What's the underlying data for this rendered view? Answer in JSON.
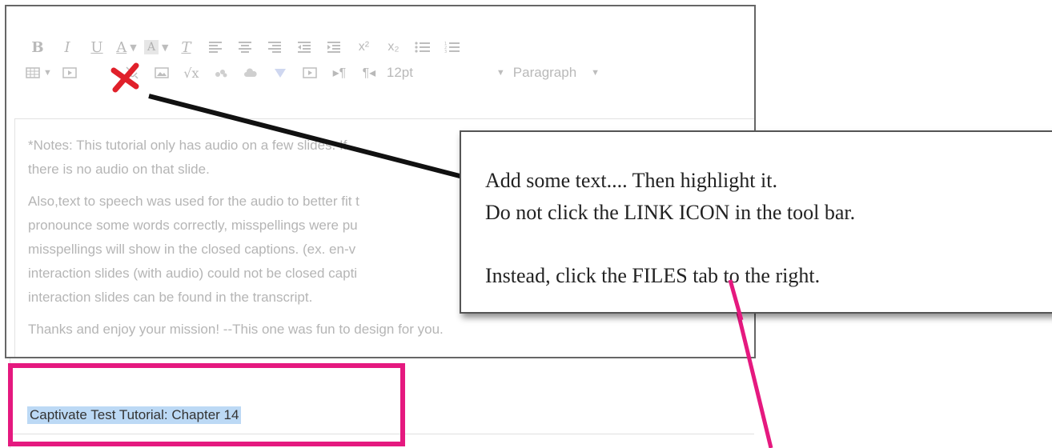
{
  "toolbar": {
    "row1": [
      "B",
      "I",
      "U",
      "A",
      "A",
      "T",
      "align-left",
      "align-center",
      "align-right",
      "indent-decrease",
      "indent-increase",
      "x²",
      "x₂",
      "bullet-list",
      "numbered-list"
    ],
    "font_size": "12pt",
    "block_format": "Paragraph",
    "underline_label": "U",
    "bold_label": "B",
    "italic_label": "I",
    "font_color_label": "A",
    "bg_color_label": "A",
    "clear_format_label": "T",
    "superscript_label": "x²",
    "subscript_label": "x₂"
  },
  "content": {
    "paragraphs": [
      "*Notes:  This tutorial only has audio on a few slides.  If there is no audio on that slide.",
      "Also,text to speech was used for the audio to better fit the pronounce some words correctly, misspellings were put misspellings will show in the closed captions.  (ex. en-v interaction slides (with audio) could not be closed capti interaction slides can be found in the transcript.",
      "Thanks and enjoy your mission!  --This one was fun to design for you."
    ],
    "line1": "*Notes:  This tutorial only has audio on a few slides.  If",
    "line2": "there is no audio on that slide.",
    "line3": "Also,text to speech was used for the audio to better fit t",
    "line4": "pronounce some words correctly, misspellings were pu",
    "line5": "misspellings will show in the closed captions.  (ex. en-v",
    "line6": "interaction slides (with audio) could not be closed capti",
    "line7": "interaction slides can be found in the transcript.",
    "line8": "Thanks and enjoy your mission!  --This one was fun to design for you."
  },
  "selection": {
    "text": "Captivate Test Tutorial:  Chapter 14"
  },
  "callout": {
    "line1": "Add some text.... Then highlight it.",
    "line2": "Do not click the LINK ICON in the tool bar.",
    "line3": "Instead, click the FILES tab to the right."
  },
  "colors": {
    "highlight_box": "#e5197f",
    "selection_bg": "#bcd9f5",
    "x_mark": "#e0202a",
    "pointer_line": "#111111"
  },
  "icons": {
    "link_icon": "link-icon",
    "x_mark": "x-mark-icon",
    "table_icon": "table-icon",
    "media_icon": "media-icon",
    "unlink_icon": "unlink-icon",
    "image_icon": "image-icon",
    "math_icon": "math-icon"
  }
}
